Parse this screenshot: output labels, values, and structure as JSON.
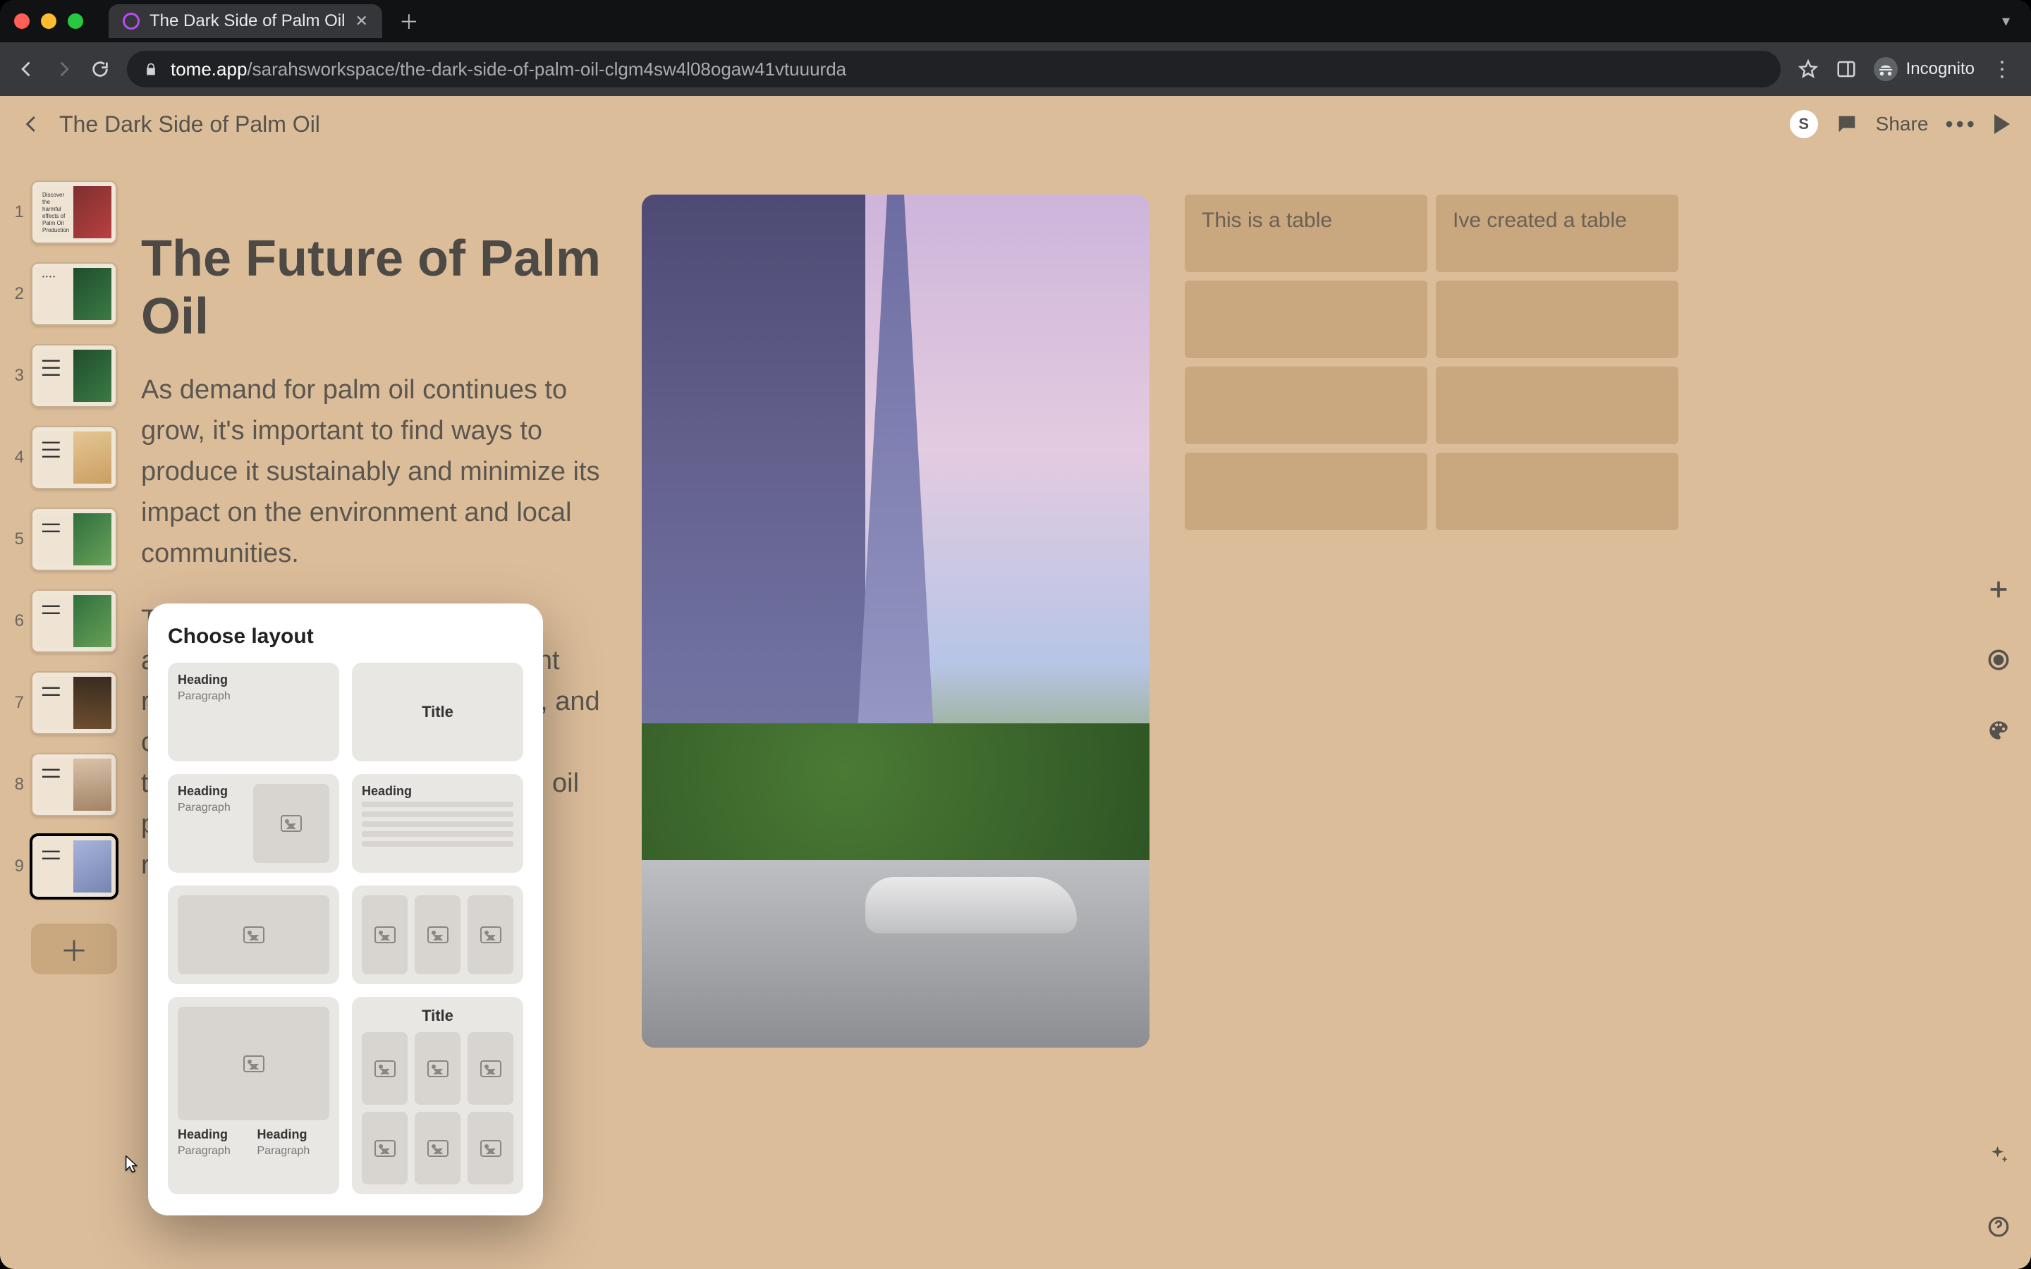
{
  "browser": {
    "tab_title": "The Dark Side of Palm Oil",
    "url_host": "tome.app",
    "url_path": "/sarahsworkspace/the-dark-side-of-palm-oil-clgm4sw4l08ogaw41vtuuurda",
    "incognito_label": "Incognito"
  },
  "app": {
    "doc_title": "The Dark Side of Palm Oil",
    "avatar_initial": "S",
    "share_label": "Share"
  },
  "slides": {
    "numbers": [
      "1",
      "2",
      "3",
      "4",
      "5",
      "6",
      "7",
      "8",
      "9"
    ],
    "selected_index": 8
  },
  "content": {
    "heading": "The Future of Palm Oil",
    "p1": "As demand for palm oil continues to grow, it's important to find ways to produce it sustainably and minimize its impact on the environment and local communities.",
    "p2": "This will require a multi-faceted approach that includes government regulations, industry collaboration, and consumer education. By working together, we can ensure that palm oil production is both profitable and responsible."
  },
  "table": {
    "cells": [
      [
        "This is a table",
        "Ive created a table"
      ],
      [
        "",
        ""
      ],
      [
        "",
        ""
      ],
      [
        "",
        ""
      ]
    ]
  },
  "popup": {
    "title": "Choose layout",
    "labels": {
      "heading": "Heading",
      "paragraph": "Paragraph",
      "title": "Title"
    }
  }
}
